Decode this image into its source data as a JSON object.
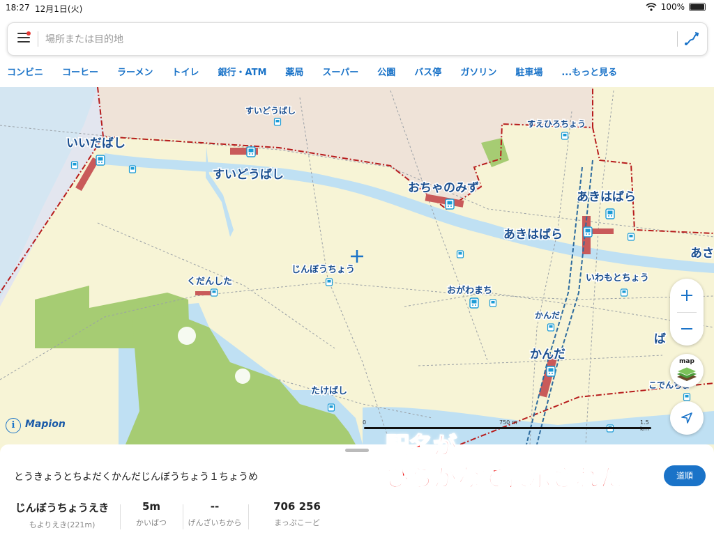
{
  "status_bar": {
    "time": "18:27",
    "date": "12月1日(火)",
    "battery": "100%"
  },
  "search": {
    "placeholder": "場所または目的地"
  },
  "categories": [
    "コンビニ",
    "コーヒー",
    "ラーメン",
    "トイレ",
    "銀行・ATM",
    "薬局",
    "スーパー",
    "公園",
    "バス停",
    "ガソリン",
    "駐車場",
    "...もっと見る"
  ],
  "map": {
    "station_labels": {
      "iidabashi": "いいだばし",
      "suidobashi_small": "すいどうばし",
      "suidobashi": "すいどうばし",
      "ochanomizu": "おちゃのみず",
      "suehirocho": "すえひろちょう",
      "akihabara_1": "あきはばら",
      "akihabara_2": "あきはばら",
      "asakusabashi_part": "あさ",
      "jimbocho": "じんぼうちょう",
      "kudanshita": "くだんした",
      "ogawamachi": "おがわまち",
      "iwamotocho": "いわもとちょう",
      "kanda_small": "かんだ",
      "kanda": "かんだ",
      "bakuro_part": "ば",
      "kodenmacho_part": "こでんちょ",
      "takebashi": "たけばし"
    },
    "scale": {
      "zero": "0",
      "mid": "750 m",
      "end": "1.5 km"
    },
    "brand": "Mapion",
    "layer_label": "map"
  },
  "bottom": {
    "address": "とうきょうとちよだくかんだじんぼうちょう１ちょうめ",
    "route_button": "道順",
    "stats": [
      {
        "value": "じんぼうちょうえき",
        "label": "もよりえき(221m)"
      },
      {
        "value": "5m",
        "label": "かいばつ"
      },
      {
        "value": "--",
        "label": "げんざいちから"
      },
      {
        "value": "706 256",
        "label": "まっぷこーど"
      }
    ]
  },
  "overlay": {
    "line1": "駅名が",
    "line2": "ひらがなで表示された"
  },
  "colors": {
    "accent": "#1a73c8",
    "land": "#f7f4d6",
    "park": "#a6cc73",
    "water": "#bfe0f3",
    "rail": "#c95a5a",
    "overlay_text": "#ee1111"
  }
}
